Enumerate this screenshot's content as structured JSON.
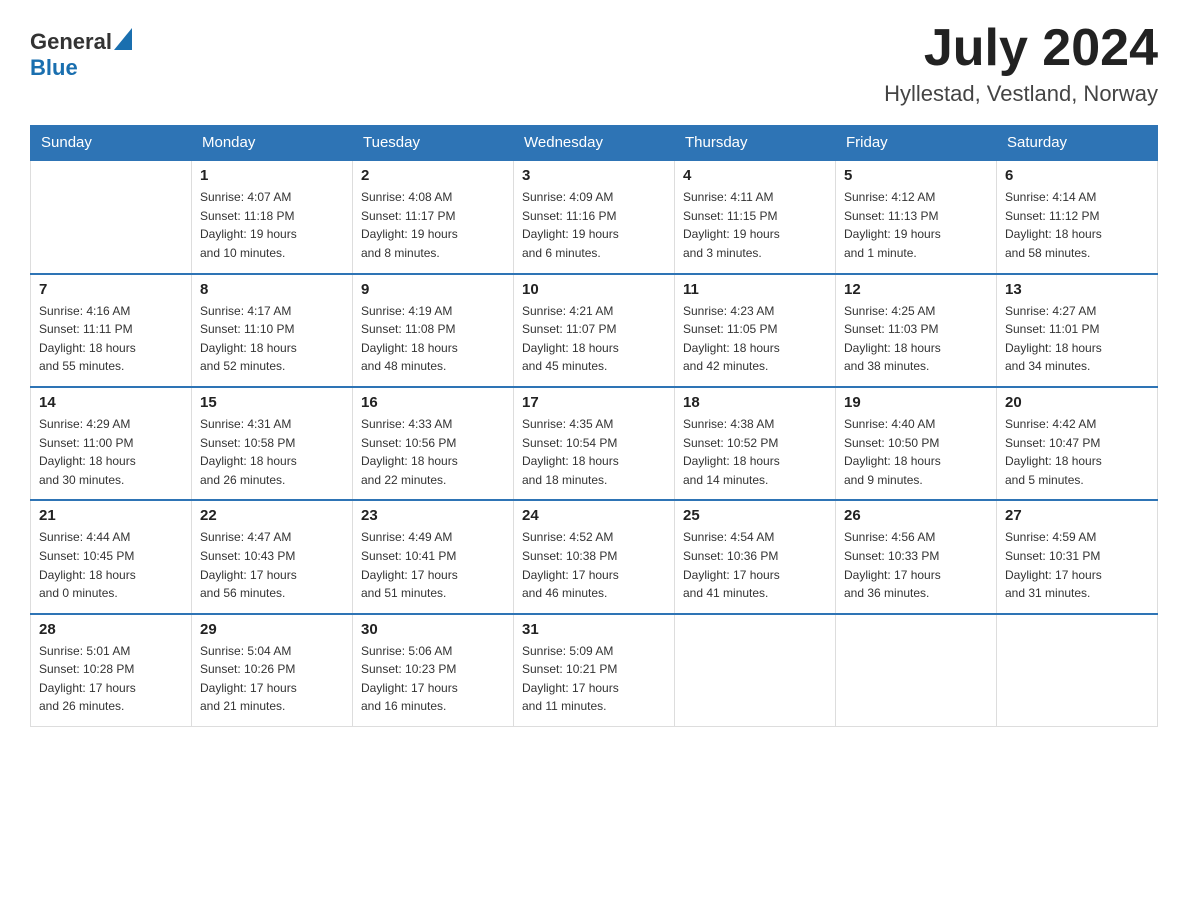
{
  "header": {
    "logo_general": "General",
    "logo_blue": "Blue",
    "month_title": "July 2024",
    "location": "Hyllestad, Vestland, Norway"
  },
  "weekdays": [
    "Sunday",
    "Monday",
    "Tuesday",
    "Wednesday",
    "Thursday",
    "Friday",
    "Saturday"
  ],
  "weeks": [
    [
      {
        "day": "",
        "info": ""
      },
      {
        "day": "1",
        "info": "Sunrise: 4:07 AM\nSunset: 11:18 PM\nDaylight: 19 hours\nand 10 minutes."
      },
      {
        "day": "2",
        "info": "Sunrise: 4:08 AM\nSunset: 11:17 PM\nDaylight: 19 hours\nand 8 minutes."
      },
      {
        "day": "3",
        "info": "Sunrise: 4:09 AM\nSunset: 11:16 PM\nDaylight: 19 hours\nand 6 minutes."
      },
      {
        "day": "4",
        "info": "Sunrise: 4:11 AM\nSunset: 11:15 PM\nDaylight: 19 hours\nand 3 minutes."
      },
      {
        "day": "5",
        "info": "Sunrise: 4:12 AM\nSunset: 11:13 PM\nDaylight: 19 hours\nand 1 minute."
      },
      {
        "day": "6",
        "info": "Sunrise: 4:14 AM\nSunset: 11:12 PM\nDaylight: 18 hours\nand 58 minutes."
      }
    ],
    [
      {
        "day": "7",
        "info": "Sunrise: 4:16 AM\nSunset: 11:11 PM\nDaylight: 18 hours\nand 55 minutes."
      },
      {
        "day": "8",
        "info": "Sunrise: 4:17 AM\nSunset: 11:10 PM\nDaylight: 18 hours\nand 52 minutes."
      },
      {
        "day": "9",
        "info": "Sunrise: 4:19 AM\nSunset: 11:08 PM\nDaylight: 18 hours\nand 48 minutes."
      },
      {
        "day": "10",
        "info": "Sunrise: 4:21 AM\nSunset: 11:07 PM\nDaylight: 18 hours\nand 45 minutes."
      },
      {
        "day": "11",
        "info": "Sunrise: 4:23 AM\nSunset: 11:05 PM\nDaylight: 18 hours\nand 42 minutes."
      },
      {
        "day": "12",
        "info": "Sunrise: 4:25 AM\nSunset: 11:03 PM\nDaylight: 18 hours\nand 38 minutes."
      },
      {
        "day": "13",
        "info": "Sunrise: 4:27 AM\nSunset: 11:01 PM\nDaylight: 18 hours\nand 34 minutes."
      }
    ],
    [
      {
        "day": "14",
        "info": "Sunrise: 4:29 AM\nSunset: 11:00 PM\nDaylight: 18 hours\nand 30 minutes."
      },
      {
        "day": "15",
        "info": "Sunrise: 4:31 AM\nSunset: 10:58 PM\nDaylight: 18 hours\nand 26 minutes."
      },
      {
        "day": "16",
        "info": "Sunrise: 4:33 AM\nSunset: 10:56 PM\nDaylight: 18 hours\nand 22 minutes."
      },
      {
        "day": "17",
        "info": "Sunrise: 4:35 AM\nSunset: 10:54 PM\nDaylight: 18 hours\nand 18 minutes."
      },
      {
        "day": "18",
        "info": "Sunrise: 4:38 AM\nSunset: 10:52 PM\nDaylight: 18 hours\nand 14 minutes."
      },
      {
        "day": "19",
        "info": "Sunrise: 4:40 AM\nSunset: 10:50 PM\nDaylight: 18 hours\nand 9 minutes."
      },
      {
        "day": "20",
        "info": "Sunrise: 4:42 AM\nSunset: 10:47 PM\nDaylight: 18 hours\nand 5 minutes."
      }
    ],
    [
      {
        "day": "21",
        "info": "Sunrise: 4:44 AM\nSunset: 10:45 PM\nDaylight: 18 hours\nand 0 minutes."
      },
      {
        "day": "22",
        "info": "Sunrise: 4:47 AM\nSunset: 10:43 PM\nDaylight: 17 hours\nand 56 minutes."
      },
      {
        "day": "23",
        "info": "Sunrise: 4:49 AM\nSunset: 10:41 PM\nDaylight: 17 hours\nand 51 minutes."
      },
      {
        "day": "24",
        "info": "Sunrise: 4:52 AM\nSunset: 10:38 PM\nDaylight: 17 hours\nand 46 minutes."
      },
      {
        "day": "25",
        "info": "Sunrise: 4:54 AM\nSunset: 10:36 PM\nDaylight: 17 hours\nand 41 minutes."
      },
      {
        "day": "26",
        "info": "Sunrise: 4:56 AM\nSunset: 10:33 PM\nDaylight: 17 hours\nand 36 minutes."
      },
      {
        "day": "27",
        "info": "Sunrise: 4:59 AM\nSunset: 10:31 PM\nDaylight: 17 hours\nand 31 minutes."
      }
    ],
    [
      {
        "day": "28",
        "info": "Sunrise: 5:01 AM\nSunset: 10:28 PM\nDaylight: 17 hours\nand 26 minutes."
      },
      {
        "day": "29",
        "info": "Sunrise: 5:04 AM\nSunset: 10:26 PM\nDaylight: 17 hours\nand 21 minutes."
      },
      {
        "day": "30",
        "info": "Sunrise: 5:06 AM\nSunset: 10:23 PM\nDaylight: 17 hours\nand 16 minutes."
      },
      {
        "day": "31",
        "info": "Sunrise: 5:09 AM\nSunset: 10:21 PM\nDaylight: 17 hours\nand 11 minutes."
      },
      {
        "day": "",
        "info": ""
      },
      {
        "day": "",
        "info": ""
      },
      {
        "day": "",
        "info": ""
      }
    ]
  ]
}
